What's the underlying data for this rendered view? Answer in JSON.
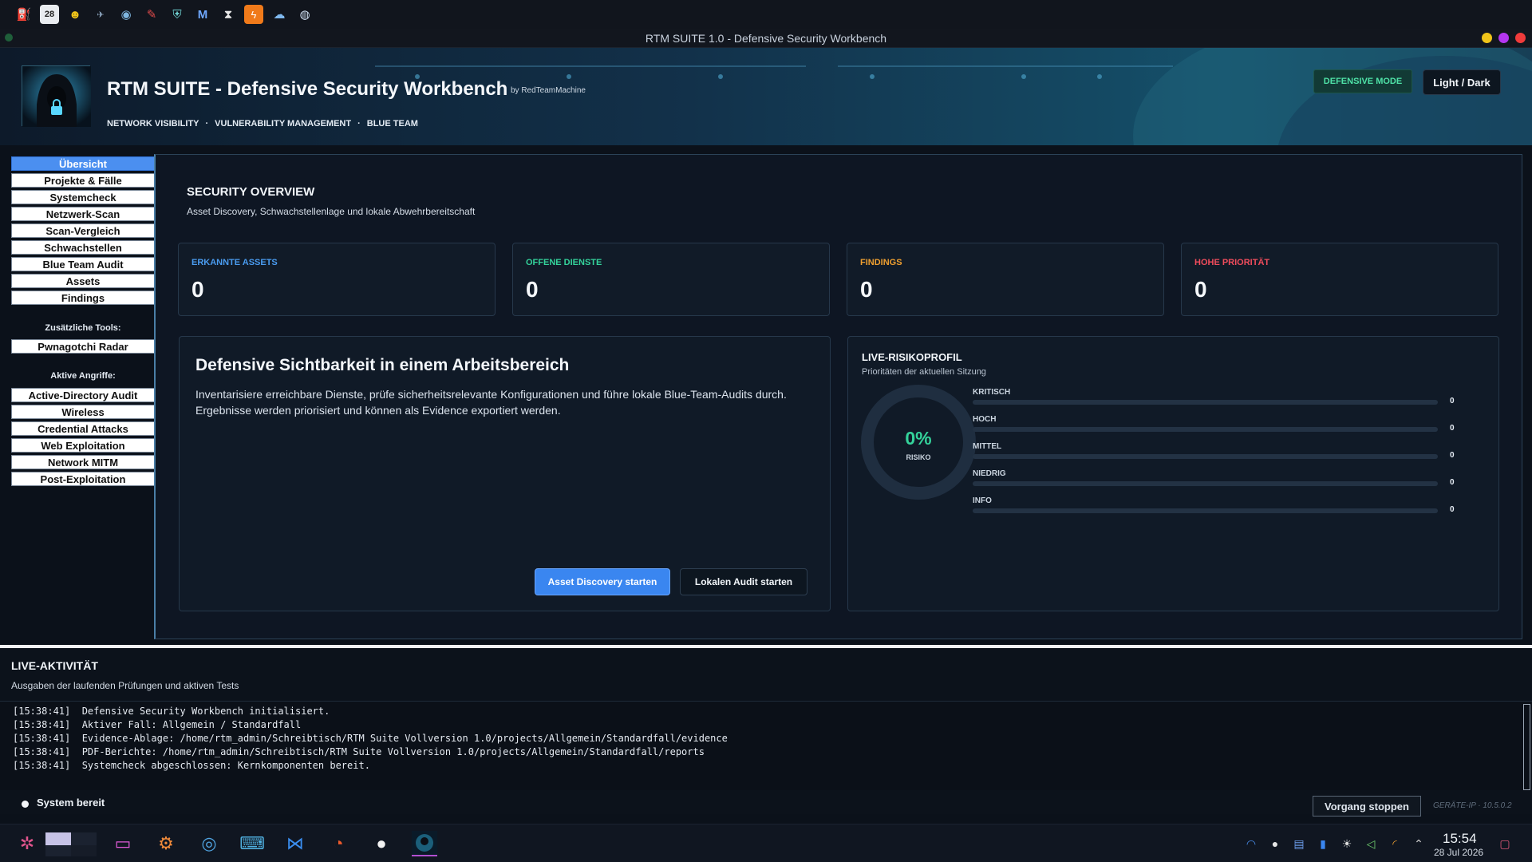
{
  "system_bar": {
    "icons": [
      "sniffer-icon",
      "calendar-icon",
      "alien-mask-icon",
      "airgeddon-icon",
      "alien-icon",
      "syringe-icon",
      "armor-icon",
      "metasploit-icon",
      "hourglass-icon",
      "burp-icon",
      "cloud-icon",
      "globe-icon"
    ],
    "calendar_day": "28"
  },
  "window": {
    "title": "RTM SUITE 1.0 - Defensive Security Workbench",
    "button_colors": [
      "#f0c419",
      "#b436f0",
      "#f03b3b"
    ]
  },
  "header": {
    "title": "RTM SUITE - Defensive Security Workbench",
    "by": "by RedTeamMachine",
    "subnav": [
      "NETWORK VISIBILITY",
      "VULNERABILITY MANAGEMENT",
      "BLUE TEAM"
    ],
    "subnav_separator": "·",
    "mode_badge": "DEFENSIVE MODE",
    "theme_toggle": "Light / Dark"
  },
  "sidebar": {
    "items": [
      "Übersicht",
      "Projekte & Fälle",
      "Systemcheck",
      "Netzwerk-Scan",
      "Scan-Vergleich",
      "Schwachstellen",
      "Blue Team Audit",
      "Assets",
      "Findings"
    ],
    "active": "Übersicht",
    "extra_tools_label": "Zusätzliche Tools:",
    "extra_tools": [
      "Pwnagotchi Radar"
    ],
    "attacks_label": "Aktive Angriffe:",
    "attacks": [
      "Active-Directory Audit",
      "Wireless",
      "Credential Attacks",
      "Web Exploitation",
      "Network MITM",
      "Post-Exploitation"
    ]
  },
  "overview": {
    "title": "SECURITY OVERVIEW",
    "subtitle": "Asset Discovery, Schwachstellenlage und lokale Abwehrbereitschaft"
  },
  "stats": [
    {
      "label": "ERKANNTE ASSETS",
      "value": "0",
      "color": "#4a9cf0"
    },
    {
      "label": "OFFENE DIENSTE",
      "value": "0",
      "color": "#34d39b"
    },
    {
      "label": "FINDINGS",
      "value": "0",
      "color": "#f0a030"
    },
    {
      "label": "HOHE PRIORITÄT",
      "value": "0",
      "color": "#f04c5c"
    }
  ],
  "hero": {
    "title": "Defensive Sichtbarkeit in einem Arbeitsbereich",
    "text": "Inventarisiere erreichbare Dienste, prüfe sicherheitsrelevante Konfigurationen und führe lokale Blue-Team-Audits durch. Ergebnisse werden priorisiert und können als Evidence exportiert werden.",
    "primary_button": "Asset Discovery starten",
    "secondary_button": "Lokalen Audit starten"
  },
  "risk": {
    "title": "LIVE-RISIKOPROFIL",
    "subtitle": "Prioritäten der aktuellen Sitzung",
    "gauge_value": "0%",
    "gauge_fraction": 0,
    "gauge_label": "RISIKO",
    "levels": [
      {
        "label": "KRITISCH",
        "count": "0",
        "fraction": 0
      },
      {
        "label": "HOCH",
        "count": "0",
        "fraction": 0
      },
      {
        "label": "MITTEL",
        "count": "0",
        "fraction": 0
      },
      {
        "label": "NIEDRIG",
        "count": "0",
        "fraction": 0
      },
      {
        "label": "INFO",
        "count": "0",
        "fraction": 0
      }
    ]
  },
  "activity": {
    "title": "LIVE-AKTIVITÄT",
    "subtitle": "Ausgaben der laufenden Prüfungen und aktiven Tests",
    "log": [
      "[15:38:41]  Defensive Security Workbench initialisiert.",
      "[15:38:41]  Aktiver Fall: Allgemein / Standardfall",
      "[15:38:41]  Evidence-Ablage: /home/rtm_admin/Schreibtisch/RTM Suite Vollversion 1.0/projects/Allgemein/Standardfall/evidence",
      "[15:38:41]  PDF-Berichte: /home/rtm_admin/Schreibtisch/RTM Suite Vollversion 1.0/projects/Allgemein/Standardfall/reports",
      "[15:38:41]  Systemcheck abgeschlossen: Kernkomponenten bereit."
    ],
    "status": "System bereit",
    "stop_button": "Vorgang stoppen",
    "device_ip": "GERÄTE-IP · 10.5.0.2"
  },
  "taskbar": {
    "apps": [
      "app-launcher-icon",
      "workspace-pager-icon",
      "file-manager-icon",
      "settings-icon",
      "chrome-icon",
      "terminal-icon",
      "vscode-icon",
      "firefox-icon",
      "github-icon",
      "rtm-suite-icon"
    ],
    "tray": [
      "vpn-icon",
      "github-tray-icon",
      "clipboard-icon",
      "storage-icon",
      "brightness-icon",
      "volume-icon",
      "wifi-icon",
      "expand-tray-icon"
    ],
    "time": "15:54",
    "date": "28 Jul 2026"
  }
}
